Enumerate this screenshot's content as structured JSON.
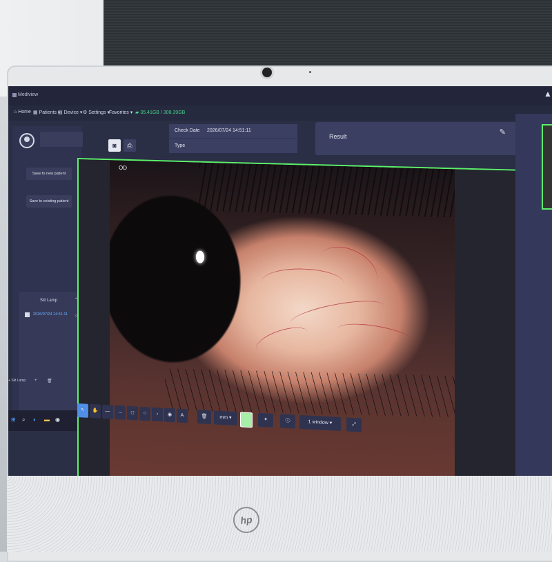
{
  "app": {
    "title": "Mediview"
  },
  "menu": {
    "home": "Home",
    "patients": "Patients",
    "device": "Device",
    "settings": "Settings",
    "favorites": "Favorites",
    "storage": "35.41GB / 308.39GB"
  },
  "left_panel": {
    "save_new": "Save to new patient",
    "save_existing": "Save to existing patient",
    "series_title": "Slit Lamp",
    "series_item_date": "2026/07/24 14:51:11",
    "bottom_tab": "Slit Lamp"
  },
  "check": {
    "date_label": "Check Date",
    "date_value": "2026/07/24 14:51:11",
    "type_label": "Type",
    "result_label": "Result"
  },
  "viewer": {
    "eye_side": "OD",
    "unit": "mm",
    "text_tool": "A",
    "window_mode": "1 window"
  },
  "colors": {
    "accent_green": "#5cf06b",
    "accent_blue": "#4f8fe6",
    "storage_green": "#48d38b",
    "panel": "#2b2f45"
  },
  "icons": {
    "camera": "camera-icon",
    "print": "print-icon",
    "edit": "pencil-icon",
    "fullscreen": "expand-icon"
  }
}
